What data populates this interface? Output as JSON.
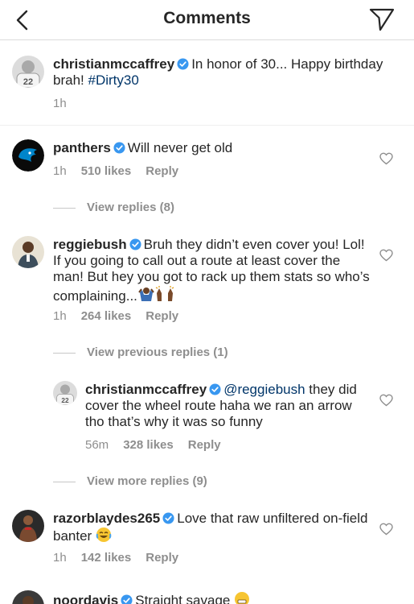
{
  "header": {
    "title": "Comments",
    "back_icon": "chevron-left-icon",
    "send_icon": "direct-send-icon"
  },
  "caption": {
    "username": "christianmccaffrey",
    "text": "In honor of 30... Happy birthday brah! ",
    "hashtag": "#Dirty30",
    "time": "1h"
  },
  "comments": [
    {
      "username": "panthers",
      "text": "Will never get old",
      "time": "1h",
      "likes": "510 likes",
      "reply": "Reply",
      "view_replies": "View replies (8)"
    },
    {
      "username": "reggiebush",
      "text": "Bruh they didn’t even cover you! Lol! If you going to call out a route at least cover the man! But hey you got to rack up them stats so who’s complaining...",
      "time": "1h",
      "likes": "264 likes",
      "reply": "Reply",
      "view_previous": "View previous replies (1)",
      "reply_comment": {
        "username": "christianmccaffrey",
        "mention": "@reggiebush",
        "text": " they did cover the wheel route haha we ran an arrow tho that’s why it was so funny",
        "time": "56m",
        "likes": "328 likes",
        "reply": "Reply"
      },
      "view_more": "View more replies (9)"
    },
    {
      "username": "razorblaydes265",
      "text": "Love that raw unfiltered on-field banter ",
      "time": "1h",
      "likes": "142 likes",
      "reply": "Reply"
    },
    {
      "username": "noordavis",
      "text": "Straight savage "
    }
  ],
  "colors": {
    "verified": "#3897f0",
    "link": "#003569",
    "muted": "#8e8e8e"
  }
}
